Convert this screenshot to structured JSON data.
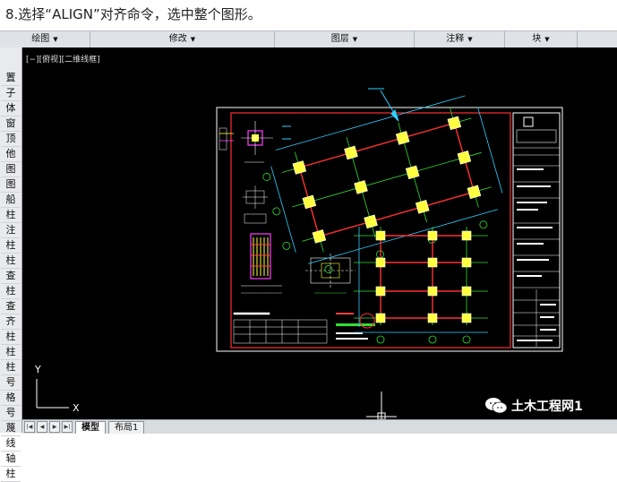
{
  "caption": "8.选择“ALIGN”对齐命令，选中整个图形。",
  "ribbon": {
    "panels": [
      "绘图",
      "修改",
      "图层",
      "注释",
      "块"
    ]
  },
  "sidebar": {
    "items": [
      "置",
      "子",
      "体",
      "窗",
      "顶",
      "他",
      "图",
      "图",
      "船",
      "柱",
      "注",
      "柱",
      "柱",
      "查",
      "柱",
      "查",
      "齐",
      "柱",
      "柱",
      "柱",
      "号",
      "格",
      "号",
      "蔑",
      "线",
      "轴",
      "柱"
    ]
  },
  "viewport": {
    "label": "[−][俯视][二维线框]",
    "background": "#000000"
  },
  "layout_tabs": {
    "model": "模型",
    "layout1": "布局1"
  },
  "watermark": {
    "text": "土木工程网1",
    "icon": "wechat-bubble-icon"
  },
  "colors": {
    "frame": "#ff3030",
    "grid": "#30e030",
    "beam": "#ff3030",
    "cyan": "#30d0ff",
    "column": "#ffff40"
  }
}
